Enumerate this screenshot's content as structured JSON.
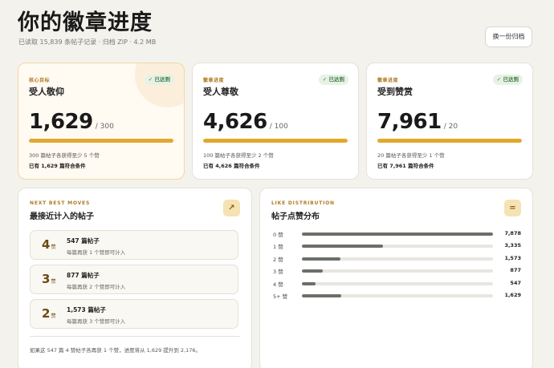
{
  "header": {
    "title": "你的徽章进度",
    "subtitle": "已读取 15,839 条帖子记录 · 归档 ZIP · 4.2 MB",
    "switch_label": "换一份归档"
  },
  "stats": [
    {
      "eyebrow": "核心目标",
      "name": "受人敬仰",
      "badge": "✓ 已达到",
      "value": "1,629",
      "denom": "/ 300",
      "progress": 1.0,
      "note1": "300 篇帖子各获得至少 5 个赞",
      "note2": "已有 1,629 篇符合条件"
    },
    {
      "eyebrow": "徽章进度",
      "name": "受人尊敬",
      "badge": "✓ 已达到",
      "value": "4,626",
      "denom": "/ 100",
      "progress": 1.0,
      "note1": "100 篇帖子各获得至少 2 个赞",
      "note2": "已有 4,626 篇符合条件"
    },
    {
      "eyebrow": "徽章进度",
      "name": "受到赞赏",
      "badge": "✓ 已达到",
      "value": "7,961",
      "denom": "/ 20",
      "progress": 1.0,
      "note1": "20 篇帖子各获得至少 1 个赞",
      "note2": "已有 7,961 篇符合条件"
    }
  ],
  "moves": {
    "eyebrow": "NEXT BEST MOVES",
    "title": "最接近计入的帖子",
    "icon": "arrow-up-right-icon",
    "icon_glyph": "↗",
    "items": [
      {
        "num": "4",
        "unit": "赞",
        "title": "547 篇帖子",
        "desc": "每篇再获 1 个赞即可计入"
      },
      {
        "num": "3",
        "unit": "赞",
        "title": "877 篇帖子",
        "desc": "每篇再获 2 个赞即可计入"
      },
      {
        "num": "2",
        "unit": "赞",
        "title": "1,573 篇帖子",
        "desc": "每篇再获 3 个赞即可计入"
      }
    ],
    "footer": "如果这 547 篇 4 赞帖子各再获 1 个赞，进度将从 1,629 提升到 2,176。"
  },
  "distribution": {
    "eyebrow": "LIKE DISTRIBUTION",
    "title": "帖子点赞分布",
    "icon": "equals-icon",
    "icon_glyph": "=",
    "rows": [
      {
        "label": "0 赞",
        "value": "7,878",
        "count": 7878
      },
      {
        "label": "1 赞",
        "value": "3,335",
        "count": 3335
      },
      {
        "label": "2 赞",
        "value": "1,573",
        "count": 1573
      },
      {
        "label": "3 赞",
        "value": "877",
        "count": 877
      },
      {
        "label": "4 赞",
        "value": "547",
        "count": 547
      },
      {
        "label": "5+ 赞",
        "value": "1,629",
        "count": 1629
      }
    ]
  },
  "colors": {
    "accent": "#e2a82e",
    "success": "#3f7a41",
    "bar_gray": "#6b6f69",
    "background": "#f4f2ec"
  }
}
